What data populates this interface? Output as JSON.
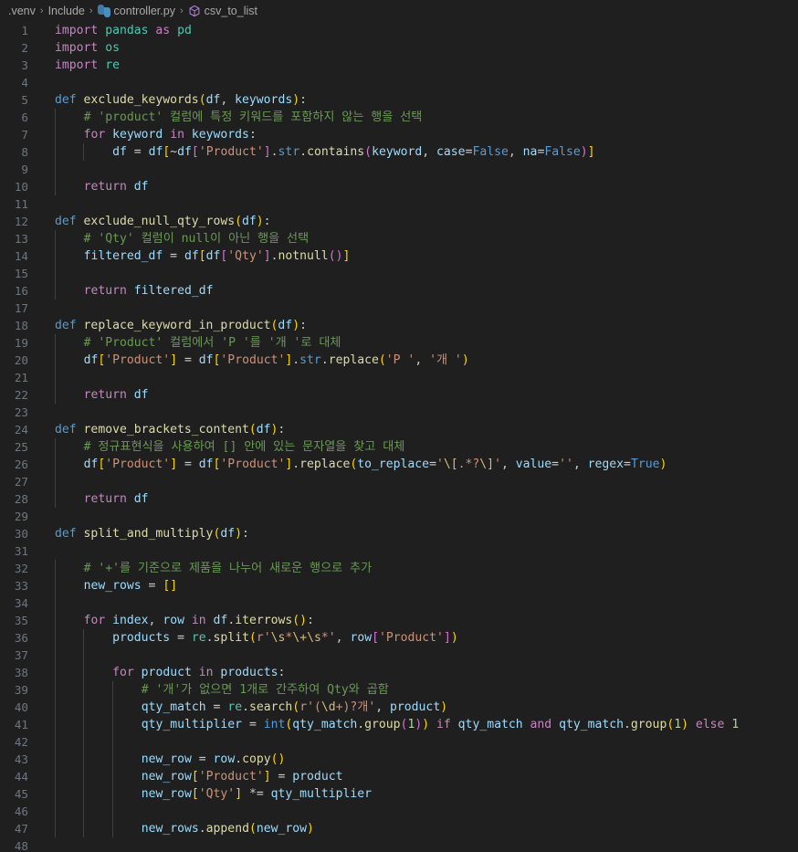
{
  "breadcrumb": {
    "items": [
      {
        "label": ".venv",
        "icon": "none"
      },
      {
        "label": "Include",
        "icon": "none"
      },
      {
        "label": "controller.py",
        "icon": "python-file-icon"
      },
      {
        "label": "csv_to_list",
        "icon": "symbol-cube-icon"
      }
    ],
    "separator": "›"
  },
  "editor": {
    "language": "python",
    "file_name": "controller.py",
    "first_line": 1,
    "last_line": 48,
    "theme": "dark-modern",
    "colors": {
      "background": "#1f1f1f",
      "line_number": "#6e7681",
      "keyword_control": "#c586c0",
      "keyword_decl": "#569cd6",
      "module": "#4ec9b0",
      "function": "#dcdcaa",
      "variable": "#9cdcfe",
      "string": "#ce9178",
      "comment": "#6a9955",
      "number": "#b5cea8",
      "bracket_1": "#ffd700",
      "bracket_2": "#da70d6",
      "bracket_3": "#179fff",
      "indent_guide": "#404040"
    },
    "lines": [
      {
        "n": 1,
        "text": "import pandas as pd"
      },
      {
        "n": 2,
        "text": "import os"
      },
      {
        "n": 3,
        "text": "import re"
      },
      {
        "n": 4,
        "text": ""
      },
      {
        "n": 5,
        "text": "def exclude_keywords(df, keywords):"
      },
      {
        "n": 6,
        "text": "    # 'product' 컬럼에 특정 키워드를 포함하지 않는 행을 선택"
      },
      {
        "n": 7,
        "text": "    for keyword in keywords:"
      },
      {
        "n": 8,
        "text": "        df = df[~df['Product'].str.contains(keyword, case=False, na=False)]"
      },
      {
        "n": 9,
        "text": ""
      },
      {
        "n": 10,
        "text": "    return df"
      },
      {
        "n": 11,
        "text": ""
      },
      {
        "n": 12,
        "text": "def exclude_null_qty_rows(df):"
      },
      {
        "n": 13,
        "text": "    # 'Qty' 컬럼이 null이 아닌 행을 선택"
      },
      {
        "n": 14,
        "text": "    filtered_df = df[df['Qty'].notnull()]"
      },
      {
        "n": 15,
        "text": ""
      },
      {
        "n": 16,
        "text": "    return filtered_df"
      },
      {
        "n": 17,
        "text": ""
      },
      {
        "n": 18,
        "text": "def replace_keyword_in_product(df):"
      },
      {
        "n": 19,
        "text": "    # 'Product' 컬럼에서 'P '를 '개 '로 대체"
      },
      {
        "n": 20,
        "text": "    df['Product'] = df['Product'].str.replace('P ', '개 ')"
      },
      {
        "n": 21,
        "text": ""
      },
      {
        "n": 22,
        "text": "    return df"
      },
      {
        "n": 23,
        "text": ""
      },
      {
        "n": 24,
        "text": "def remove_brackets_content(df):"
      },
      {
        "n": 25,
        "text": "    # 정규표현식을 사용하여 [] 안에 있는 문자열을 찾고 대체"
      },
      {
        "n": 26,
        "text": "    df['Product'] = df['Product'].replace(to_replace='\\[.*?\\]', value='', regex=True)"
      },
      {
        "n": 27,
        "text": ""
      },
      {
        "n": 28,
        "text": "    return df"
      },
      {
        "n": 29,
        "text": ""
      },
      {
        "n": 30,
        "text": "def split_and_multiply(df):"
      },
      {
        "n": 31,
        "text": ""
      },
      {
        "n": 32,
        "text": "    # '+'를 기준으로 제품을 나누어 새로운 행으로 추가"
      },
      {
        "n": 33,
        "text": "    new_rows = []"
      },
      {
        "n": 34,
        "text": ""
      },
      {
        "n": 35,
        "text": "    for index, row in df.iterrows():"
      },
      {
        "n": 36,
        "text": "        products = re.split(r'\\s*\\+\\s*', row['Product'])"
      },
      {
        "n": 37,
        "text": ""
      },
      {
        "n": 38,
        "text": "        for product in products:"
      },
      {
        "n": 39,
        "text": "            # '개'가 없으면 1개로 간주하여 Qty와 곱함"
      },
      {
        "n": 40,
        "text": "            qty_match = re.search(r'(\\d+)?개', product)"
      },
      {
        "n": 41,
        "text": "            qty_multiplier = int(qty_match.group(1)) if qty_match and qty_match.group(1) else 1"
      },
      {
        "n": 42,
        "text": ""
      },
      {
        "n": 43,
        "text": "            new_row = row.copy()"
      },
      {
        "n": 44,
        "text": "            new_row['Product'] = product"
      },
      {
        "n": 45,
        "text": "            new_row['Qty'] *= qty_multiplier"
      },
      {
        "n": 46,
        "text": ""
      },
      {
        "n": 47,
        "text": "            new_rows.append(new_row)"
      },
      {
        "n": 48,
        "text": ""
      }
    ]
  }
}
